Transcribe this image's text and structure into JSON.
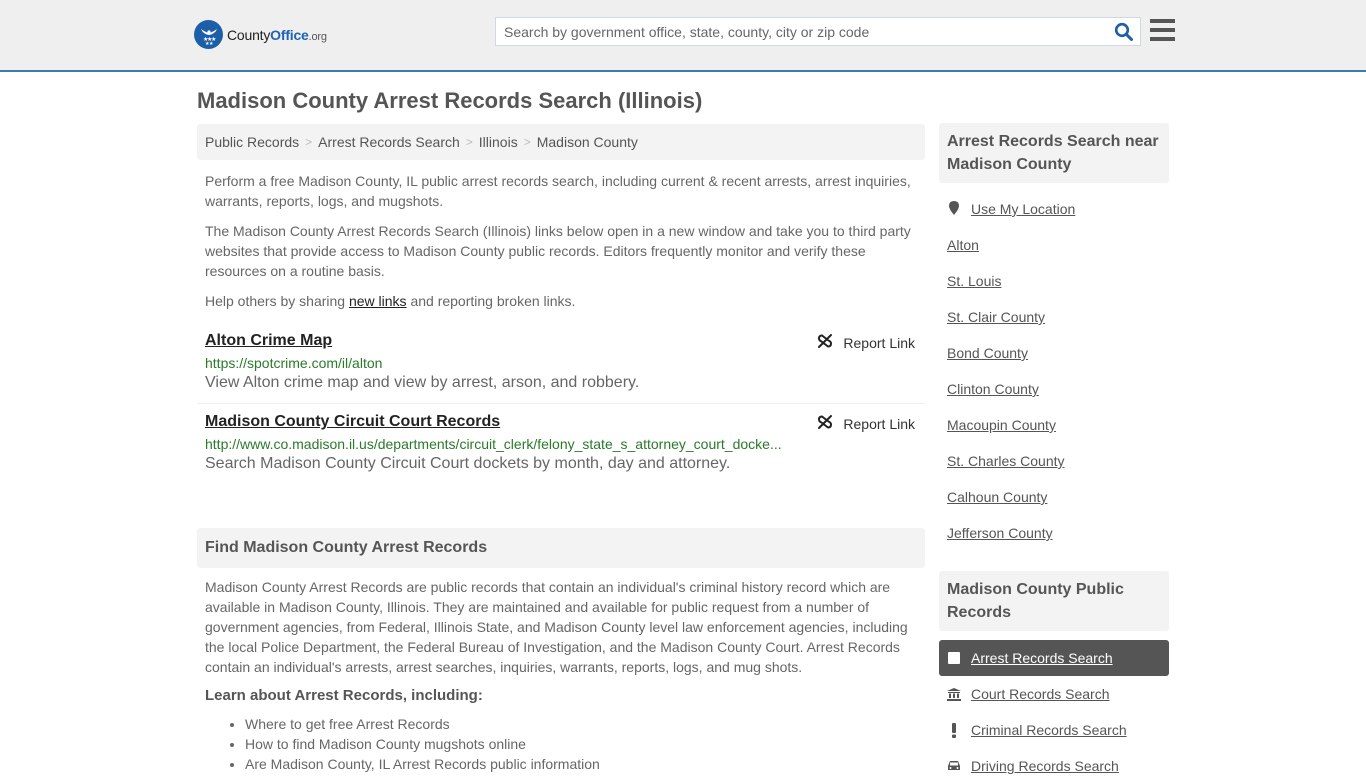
{
  "header": {
    "logo": {
      "county": "County",
      "office": "Office",
      "org": ".org"
    },
    "search": {
      "placeholder": "Search by government office, state, county, city or zip code",
      "value": ""
    },
    "colors": {
      "brand_blue": "#1c5fa8",
      "header_border": "#3a7cac"
    }
  },
  "page": {
    "title": "Madison County Arrest Records Search (Illinois)"
  },
  "breadcrumb": [
    {
      "label": "Public Records"
    },
    {
      "label": "Arrest Records Search"
    },
    {
      "label": "Illinois"
    },
    {
      "label": "Madison County"
    }
  ],
  "intro": {
    "p1": "Perform a free Madison County, IL public arrest records search, including current & recent arrests, arrest inquiries, warrants, reports, logs, and mugshots.",
    "p2": "The Madison County Arrest Records Search (Illinois) links below open in a new window and take you to third party websites that provide access to Madison County public records. Editors frequently monitor and verify these resources on a routine basis.",
    "p3_before": "Help others by sharing ",
    "p3_link": "new links",
    "p3_after": " and reporting broken links."
  },
  "links": [
    {
      "title": "Alton Crime Map",
      "url": "https://spotcrime.com/il/alton",
      "description": "View Alton crime map and view by arrest, arson, and robbery.",
      "report_label": "Report Link"
    },
    {
      "title": "Madison County Circuit Court Records",
      "url": "http://www.co.madison.il.us/departments/circuit_clerk/felony_state_s_attorney_court_docke...",
      "description": "Search Madison County Circuit Court dockets by month, day and attorney.",
      "report_label": "Report Link"
    }
  ],
  "find_section": {
    "heading": "Find Madison County Arrest Records",
    "body": "Madison County Arrest Records are public records that contain an individual's criminal history record which are available in Madison County, Illinois. They are maintained and available for public request from a number of government agencies, from Federal, Illinois State, and Madison County level law enforcement agencies, including the local Police Department, the Federal Bureau of Investigation, and the Madison County Court. Arrest Records contain an individual's arrests, arrest searches, inquiries, warrants, reports, logs, and mug shots.",
    "learn_heading": "Learn about Arrest Records, including:",
    "learn_items": [
      "Where to get free Arrest Records",
      "How to find Madison County mugshots online",
      "Are Madison County, IL Arrest Records public information"
    ]
  },
  "sidebar": {
    "nearby_heading": "Arrest Records Search near Madison County",
    "use_location": "Use My Location",
    "nearby": [
      "Alton",
      "St. Louis",
      "St. Clair County",
      "Bond County",
      "Clinton County",
      "Macoupin County",
      "St. Charles County",
      "Calhoun County",
      "Jefferson County"
    ],
    "public_heading": "Madison County Public Records",
    "public_records": [
      {
        "label": "Arrest Records Search",
        "icon": "square-icon",
        "active": true
      },
      {
        "label": "Court Records Search",
        "icon": "courthouse-icon",
        "active": false
      },
      {
        "label": "Criminal Records Search",
        "icon": "exclamation-icon",
        "active": false
      },
      {
        "label": "Driving Records Search",
        "icon": "car-icon",
        "active": false
      }
    ]
  }
}
